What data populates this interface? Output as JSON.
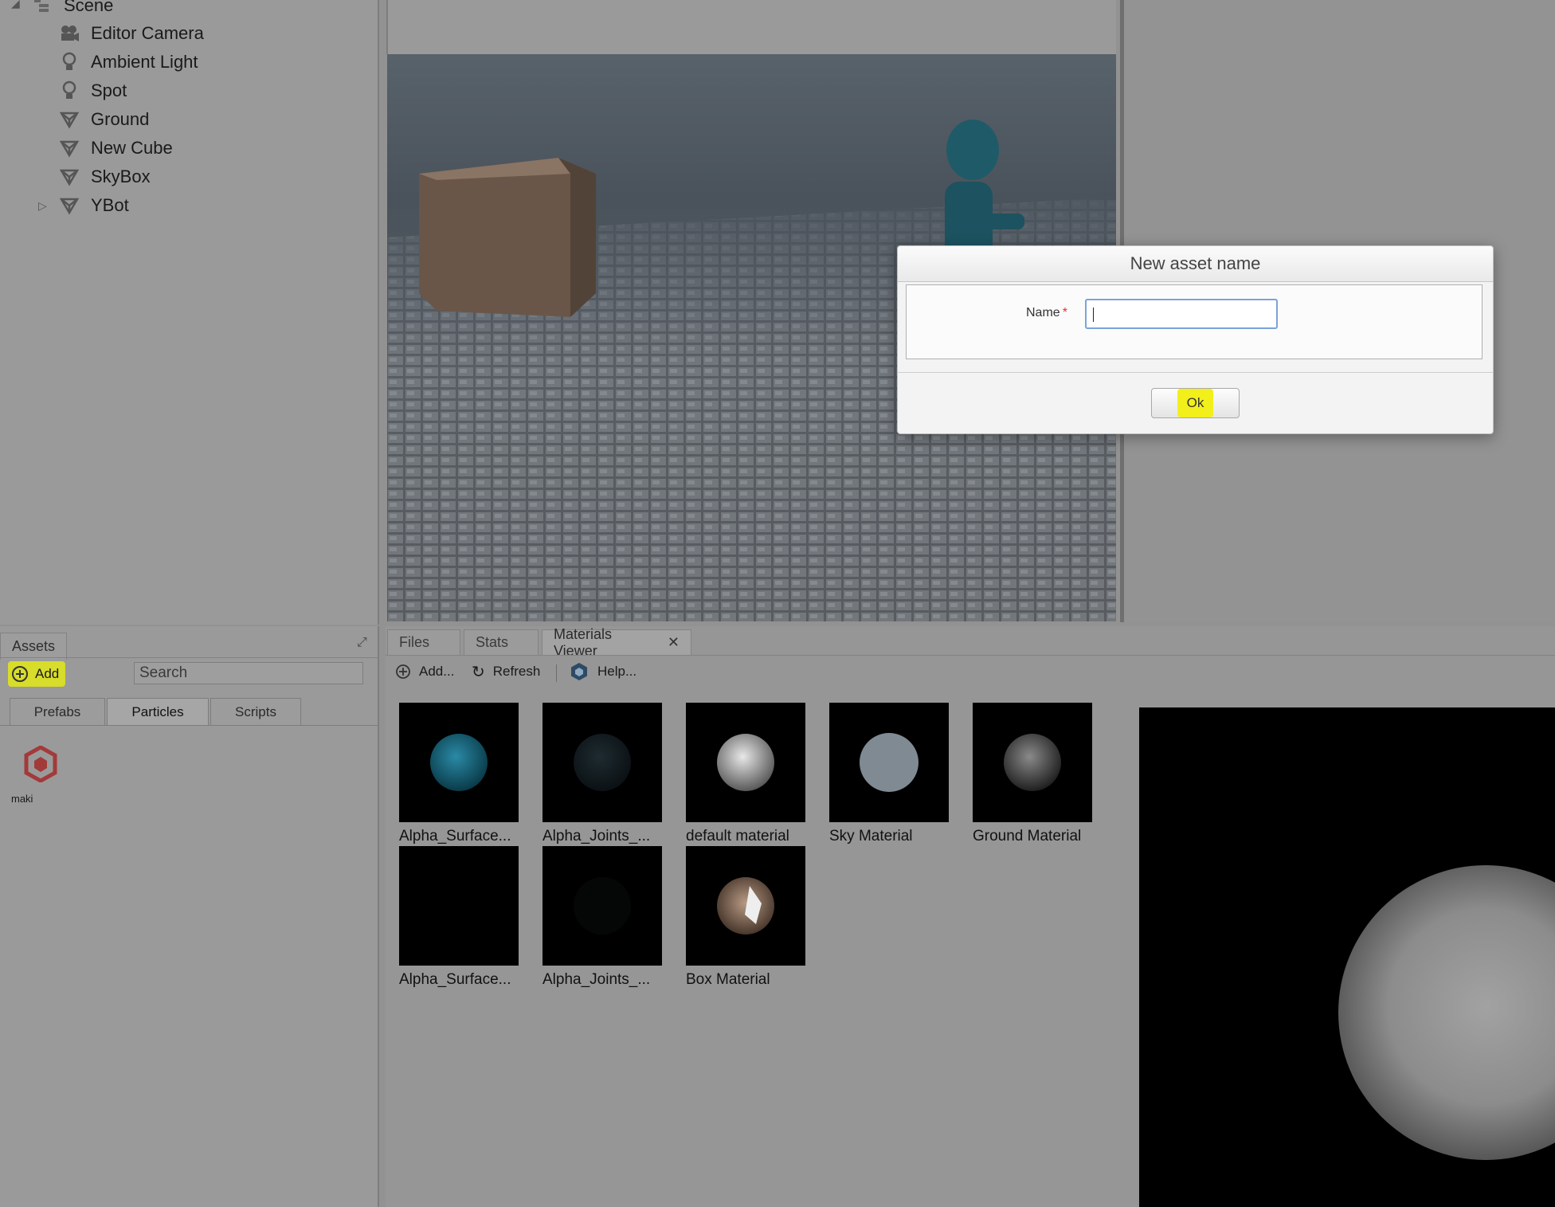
{
  "scene_tree": {
    "root": "Scene",
    "items": [
      {
        "label": "Editor Camera",
        "icon": "camera-icon"
      },
      {
        "label": "Ambient Light",
        "icon": "light-bulb-icon"
      },
      {
        "label": "Spot",
        "icon": "light-bulb-icon"
      },
      {
        "label": "Ground",
        "icon": "mesh-icon"
      },
      {
        "label": "New Cube",
        "icon": "mesh-icon"
      },
      {
        "label": "SkyBox",
        "icon": "mesh-icon"
      },
      {
        "label": "YBot",
        "icon": "mesh-icon"
      }
    ]
  },
  "assets": {
    "tab_label": "Assets",
    "add_label": "Add",
    "search_value": "Search",
    "subtabs": [
      "Prefabs",
      "Particles",
      "Scripts"
    ],
    "active_subtab": "Particles",
    "items": [
      {
        "label": "maki",
        "icon": "particle-system-icon"
      }
    ]
  },
  "bottom_tabs": [
    "Files",
    "Stats",
    "Materials Viewer"
  ],
  "materials_toolbar": {
    "add": "Add...",
    "refresh": "Refresh",
    "help": "Help..."
  },
  "materials": [
    "Alpha_Surface...",
    "Alpha_Joints_...",
    "default material",
    "Sky Material",
    "Ground Material",
    "Alpha_Surface...",
    "Alpha_Joints_...",
    "Box Material"
  ],
  "dialog": {
    "title": "New asset name",
    "name_label": "Name",
    "required_mark": "*",
    "name_value": "",
    "ok_label": "Ok"
  },
  "colors": {
    "highlight": "#f2ef1b",
    "overlay": "#929292",
    "input_focus": "#7aa3d9"
  }
}
